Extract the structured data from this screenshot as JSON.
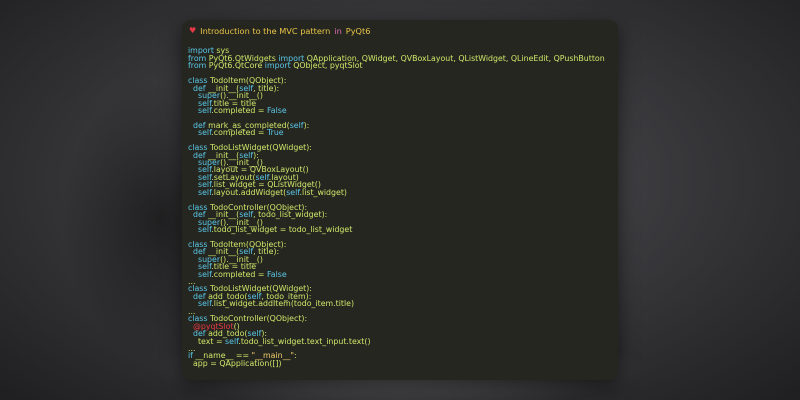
{
  "window": {
    "title_prefix": "Introduction to the MVC pattern",
    "title_in": "in",
    "title_lib": "PyQt6"
  },
  "code_lines": [
    "",
    "import sys",
    "from PyQt6.QtWidgets import QApplication, QWidget, QVBoxLayout, QListWidget, QLineEdit, QPushButton",
    "from PyQt6.QtCore import QObject, pyqtSlot",
    "",
    "class TodoItem(QObject):",
    "  def __init__(self, title):",
    "    super().__init__()",
    "    self.title = title",
    "    self.completed = False",
    "",
    "  def mark_as_completed(self):",
    "    self.completed = True",
    "",
    "class TodoListWidget(QWidget):",
    "  def __init__(self):",
    "    super().__init__()",
    "    self.layout = QVBoxLayout()",
    "    self.setLayout(self.layout)",
    "    self.list_widget = QListWidget()",
    "    self.layout.addWidget(self.list_widget)",
    "",
    "class TodoController(QObject):",
    "  def __init__(self, todo_list_widget):",
    "    super().__init__()",
    "    self.todo_list_widget = todo_list_widget",
    "",
    "class TodoItem(QObject):",
    "  def __init__(self, title):",
    "    super().__init__()",
    "    self.title = title",
    "    self.completed = False",
    "...",
    "class TodoListWidget(QWidget):",
    "  def add_todo(self, todo_item):",
    "    self.list_widget.addItem(todo_item.title)",
    "...",
    "class TodoController(QObject):",
    "  @pyqtSlot()",
    "  def add_todo(self):",
    "    text = self.todo_list_widget.text_input.text()",
    "...",
    "if __name__ == \"__main__\":",
    "  app = QApplication([])"
  ],
  "colors": {
    "background": "#262620",
    "code": "#cfe86a",
    "keyword": "#59c8e8",
    "title": "#e8c547",
    "heart": "#e63946"
  },
  "icons": {
    "title": "heart-icon"
  }
}
